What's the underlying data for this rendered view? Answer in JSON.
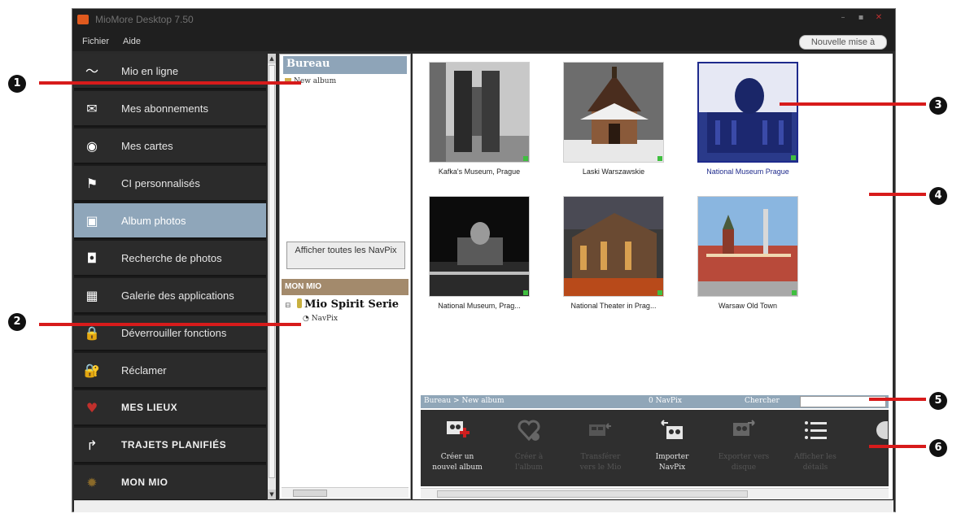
{
  "app": {
    "title": "MioMore Desktop 7.50",
    "menu": [
      "Fichier",
      "Aide"
    ],
    "update_button": "Nouvelle mise à",
    "window_controls": [
      "minimize-icon",
      "maximize-icon",
      "close-icon"
    ]
  },
  "sidebar": {
    "items": [
      {
        "label": "Mio en ligne",
        "icon": "wave-icon",
        "active": false,
        "caps": false
      },
      {
        "label": "Mes abonnements",
        "icon": "envelope-icon",
        "active": false,
        "caps": false
      },
      {
        "label": "Mes cartes",
        "icon": "compass-icon",
        "active": false,
        "caps": false
      },
      {
        "label": "CI personnalisés",
        "icon": "flag-icon",
        "active": false,
        "caps": false
      },
      {
        "label": "Album photos",
        "icon": "photos-icon",
        "active": true,
        "caps": false
      },
      {
        "label": "Recherche de photos",
        "icon": "camera-icon",
        "active": false,
        "caps": false
      },
      {
        "label": "Galerie des applications",
        "icon": "grid-icon",
        "active": false,
        "caps": false
      },
      {
        "label": "Déverrouiller fonctions",
        "icon": "lock-icon",
        "active": false,
        "caps": false
      },
      {
        "label": "Réclamer",
        "icon": "claim-lock-icon",
        "active": false,
        "caps": false
      },
      {
        "label": "MES LIEUX",
        "icon": "heart-icon",
        "active": false,
        "caps": true
      },
      {
        "label": "TRAJETS PLANIFIÉS",
        "icon": "route-icon",
        "active": false,
        "caps": true
      },
      {
        "label": "MON MIO",
        "icon": "gear-icon",
        "active": false,
        "caps": true
      }
    ]
  },
  "middle": {
    "bureau_title": "Bureau",
    "album_item": "New album",
    "show_all_button": "Afficher toutes les NavPix",
    "mon_mio_title": "MON MIO",
    "device_name": "Mio Spirit Serie",
    "navpix_item": "NavPix"
  },
  "photos": [
    {
      "caption": "Kafka's Museum, Prague",
      "selected": false,
      "scene": "statue"
    },
    {
      "caption": "Laski Warszawskie",
      "selected": false,
      "scene": "church"
    },
    {
      "caption": "National Museum Prague",
      "selected": true,
      "scene": "museum-blue"
    },
    {
      "caption": "National Museum, Prag...",
      "selected": false,
      "scene": "night"
    },
    {
      "caption": "National Theater in Prag...",
      "selected": false,
      "scene": "theater"
    },
    {
      "caption": "Warsaw Old Town",
      "selected": false,
      "scene": "oldtown"
    }
  ],
  "status": {
    "path": "Bureau > New album",
    "count": "0 NavPix",
    "search_label": "Chercher"
  },
  "toolbar": [
    {
      "label": "Créer un nouvel album",
      "icon": "create-album-icon",
      "enabled": true
    },
    {
      "label": "Créer à l'album",
      "icon": "favorite-album-icon",
      "enabled": false
    },
    {
      "label": "Transférer vers le Mio",
      "icon": "transfer-to-device-icon",
      "enabled": false
    },
    {
      "label": "Importer NavPix",
      "icon": "import-navpix-icon",
      "enabled": true
    },
    {
      "label": "Exporter vers disque",
      "icon": "export-icon",
      "enabled": false
    },
    {
      "label": "Afficher les détails",
      "icon": "list-details-icon",
      "enabled": false
    }
  ],
  "callouts": [
    "1",
    "2",
    "3",
    "4",
    "5",
    "6"
  ],
  "colors": {
    "sidebar_active": "#8fa6ba",
    "callout_red": "#d71b1b",
    "selected_border": "#1e2a8c"
  }
}
